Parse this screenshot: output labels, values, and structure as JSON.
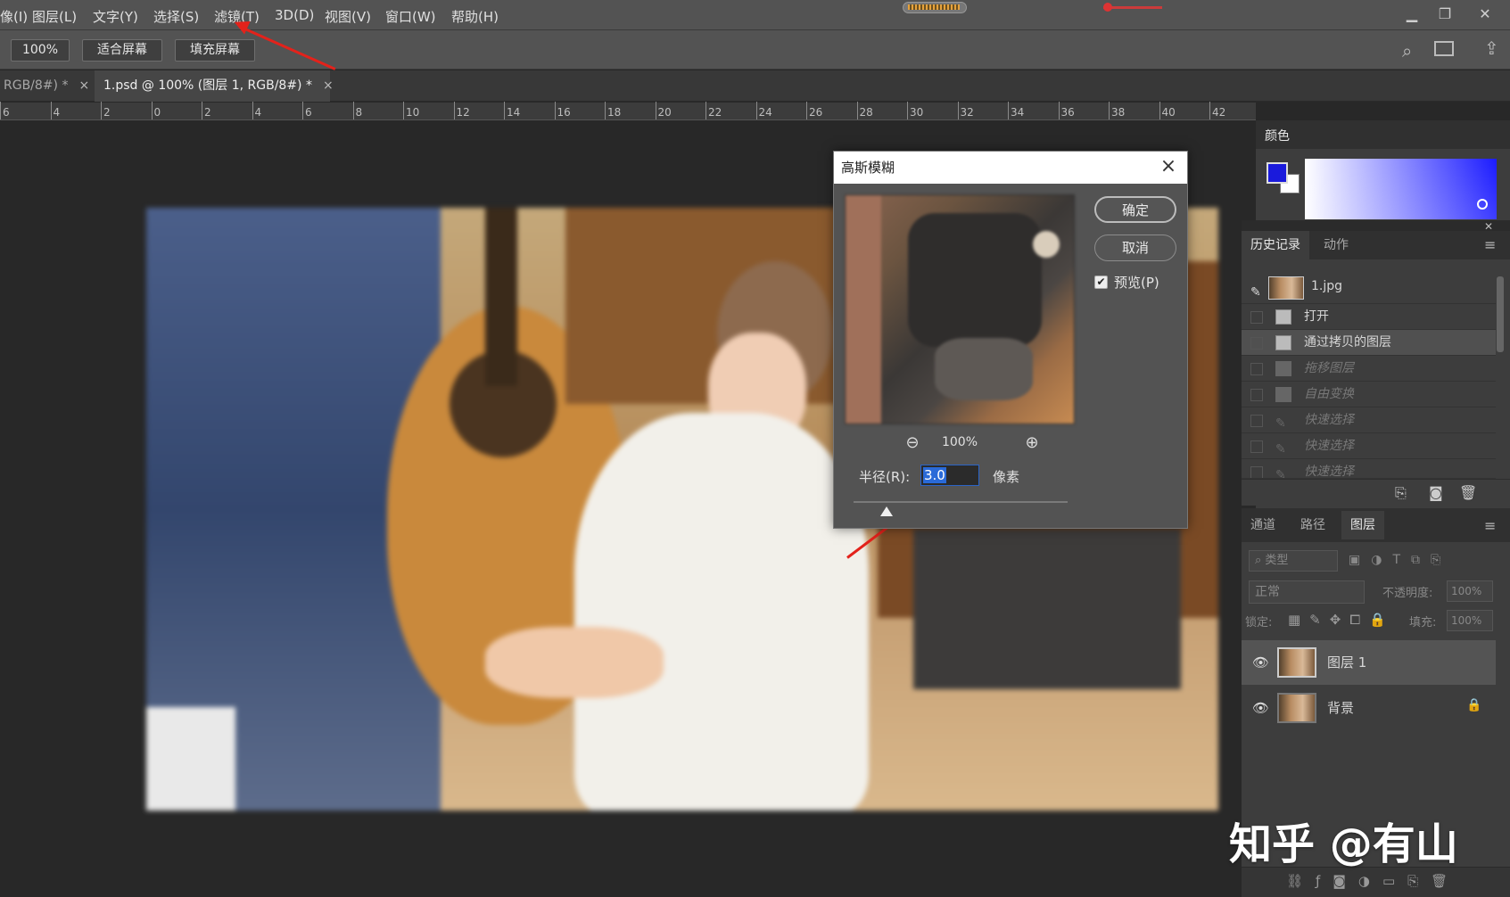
{
  "menu": [
    "像(I)",
    "图层(L)",
    "文字(Y)",
    "选择(S)",
    "滤镜(T)",
    "3D(D)",
    "视图(V)",
    "窗口(W)",
    "帮助(H)"
  ],
  "options": {
    "zoom": "100%",
    "fit_screen": "适合屏幕",
    "fill_screen": "填充屏幕"
  },
  "tabs": [
    {
      "label": "RGB/8#) *",
      "close": "×"
    },
    {
      "label": "1.psd @ 100% (图层 1, RGB/8#) *",
      "close": "×"
    }
  ],
  "ruler": [
    "6",
    "4",
    "2",
    "0",
    "2",
    "4",
    "6",
    "8",
    "10",
    "12",
    "14",
    "16",
    "18",
    "20",
    "22",
    "24",
    "26",
    "28",
    "30",
    "32",
    "34",
    "36",
    "38",
    "40",
    "42"
  ],
  "color_panel": {
    "title": "颜色",
    "foreground": "#1a1adc",
    "background": "#ffffff"
  },
  "history_panel": {
    "tabs": [
      "历史记录",
      "动作"
    ],
    "snapshot": "1.jpg",
    "steps": [
      "打开",
      "通过拷贝的图层",
      "拖移图层",
      "自由变换",
      "快速选择",
      "快速选择",
      "快速选择"
    ]
  },
  "layers_panel": {
    "tabs": [
      "通道",
      "路径",
      "图层"
    ],
    "filter_placeholder": "类型",
    "blend_mode": "正常",
    "opacity_label": "不透明度:",
    "opacity": "100%",
    "lock_label": "锁定:",
    "fill_label": "填充:",
    "fill": "100%",
    "layers": [
      {
        "name": "图层 1"
      },
      {
        "name": "背景"
      }
    ]
  },
  "dialog": {
    "title": "高斯模糊",
    "ok": "确定",
    "cancel": "取消",
    "preview_label": "预览(P)",
    "zoom": "100%",
    "radius_label": "半径(R):",
    "radius_value": "3.0",
    "unit": "像素"
  },
  "watermark": "知乎 @有山"
}
